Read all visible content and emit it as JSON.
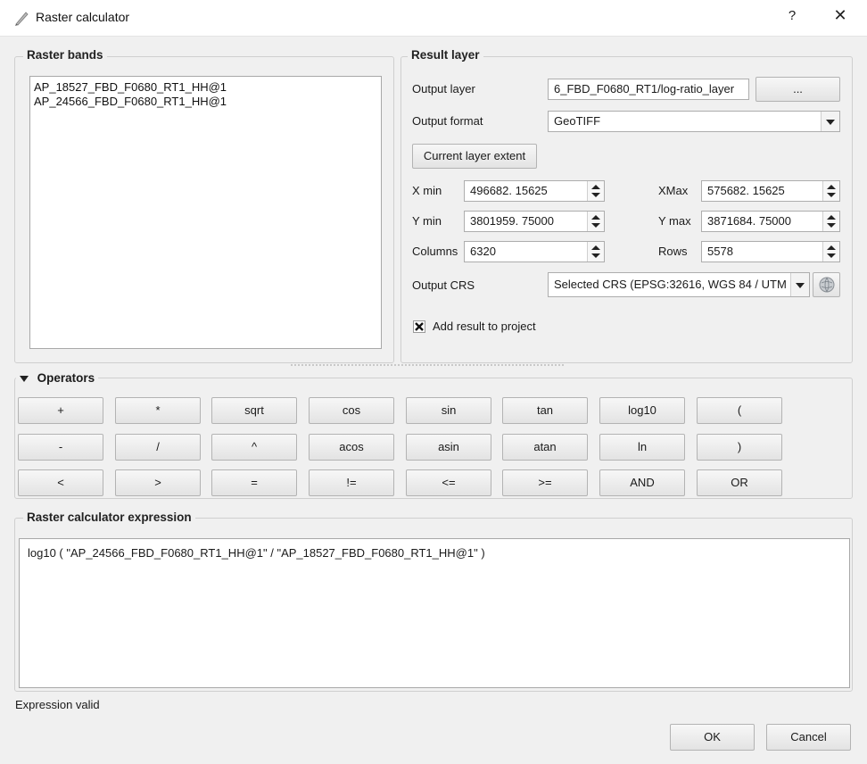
{
  "window": {
    "title": "Raster calculator",
    "help": "?",
    "close": "✕"
  },
  "raster_bands": {
    "title": "Raster bands",
    "items": [
      "AP_18527_FBD_F0680_RT1_HH@1",
      "AP_24566_FBD_F0680_RT1_HH@1"
    ]
  },
  "result_layer": {
    "title": "Result layer",
    "output_layer_label": "Output layer",
    "output_layer_value": "6_FBD_F0680_RT1/log-ratio_layer",
    "browse_label": "...",
    "output_format_label": "Output format",
    "output_format_value": "GeoTIFF",
    "current_extent_label": "Current layer extent",
    "xmin_label": "X min",
    "xmin_value": "496682. 15625",
    "xmax_label": "XMax",
    "xmax_value": "575682. 15625",
    "ymin_label": "Y min",
    "ymin_value": "3801959. 75000",
    "ymax_label": "Y max",
    "ymax_value": "3871684. 75000",
    "columns_label": "Columns",
    "columns_value": "6320",
    "rows_label": "Rows",
    "rows_value": "5578",
    "crs_label": "Output CRS",
    "crs_value": "Selected CRS (EPSG:32616, WGS 84 / UTM",
    "add_result_label": "Add result to project",
    "add_result_checked": true
  },
  "operators": {
    "title": "Operators",
    "row1": [
      "+",
      "*",
      "sqrt",
      "cos",
      "sin",
      "tan",
      "log10",
      "("
    ],
    "row2": [
      "-",
      "/",
      "^",
      "acos",
      "asin",
      "atan",
      "ln",
      ")"
    ],
    "row3": [
      "<",
      ">",
      "=",
      "!=",
      "<=",
      ">=",
      "AND",
      "OR"
    ]
  },
  "expression": {
    "title": "Raster calculator expression",
    "text": "log10 ( \"AP_24566_FBD_F0680_RT1_HH@1\" / \"AP_18527_FBD_F0680_RT1_HH@1\" )",
    "status": "Expression valid"
  },
  "footer": {
    "ok_label": "OK",
    "cancel_label": "Cancel"
  }
}
